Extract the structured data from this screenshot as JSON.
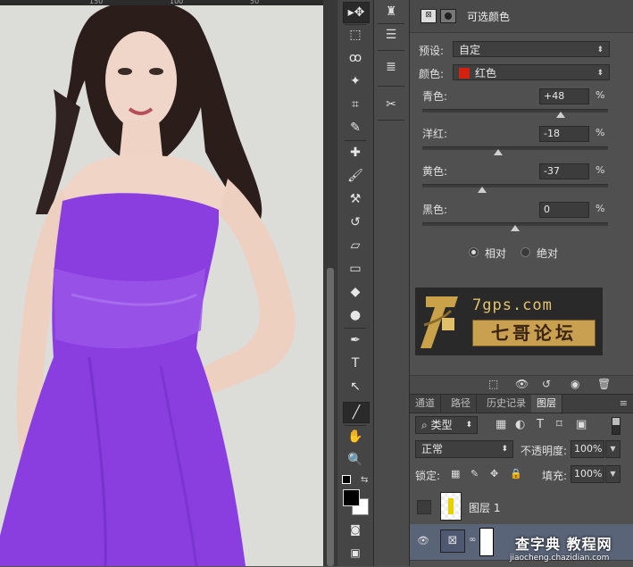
{
  "ruler": {
    "ticks": [
      "150",
      "100",
      "50"
    ]
  },
  "tools": [
    {
      "icon": "move-icon",
      "glyph": "▸✥"
    },
    {
      "icon": "marquee-icon",
      "glyph": "⬚"
    },
    {
      "icon": "lasso-icon",
      "glyph": "ꝏ"
    },
    {
      "icon": "magic-wand-icon",
      "glyph": "✦"
    },
    {
      "icon": "crop-icon",
      "glyph": "⌗"
    },
    {
      "icon": "eyedropper-icon",
      "glyph": "✎"
    },
    {
      "icon": "healing-brush-icon",
      "glyph": "✚"
    },
    {
      "icon": "brush-icon",
      "glyph": "🖌"
    },
    {
      "icon": "clone-stamp-icon",
      "glyph": "⚒"
    },
    {
      "icon": "history-brush-icon",
      "glyph": "↺"
    },
    {
      "icon": "eraser-icon",
      "glyph": "▱"
    },
    {
      "icon": "gradient-icon",
      "glyph": "▭"
    },
    {
      "icon": "blur-icon",
      "glyph": "◆"
    },
    {
      "icon": "dodge-icon",
      "glyph": "●"
    },
    {
      "icon": "pen-icon",
      "glyph": "✒"
    },
    {
      "icon": "type-icon",
      "glyph": "T"
    },
    {
      "icon": "path-selection-icon",
      "glyph": "↖"
    },
    {
      "icon": "line-icon",
      "glyph": "╱"
    },
    {
      "icon": "hand-icon",
      "glyph": "✋"
    },
    {
      "icon": "zoom-icon",
      "glyph": "🔍"
    }
  ],
  "properties": {
    "title": "可选颜色",
    "preset_label": "预设:",
    "preset_value": "自定",
    "colors_label": "颜色:",
    "colors_value": "红色",
    "colors_swatch": "#d4200f",
    "sliders": [
      {
        "label": "青色:",
        "value": "+48",
        "pct": "%",
        "level": 0.74
      },
      {
        "label": "洋红:",
        "value": "-18",
        "pct": "%",
        "level": 0.41
      },
      {
        "label": "黄色:",
        "value": "-37",
        "pct": "%",
        "level": 0.32
      },
      {
        "label": "黑色:",
        "value": "0",
        "pct": "%",
        "level": 0.5
      }
    ],
    "method_relative": "相对",
    "method_absolute": "绝对",
    "method_selected": "relative",
    "watermark_url": "7gps.com",
    "watermark_name": "七哥论坛"
  },
  "layers": {
    "tabs": [
      "通道",
      "路径",
      "历史记录",
      "图层"
    ],
    "active_tab": 3,
    "filter_kind": "类型",
    "blend_mode": "正常",
    "opacity_label": "不透明度:",
    "opacity_value": "100%",
    "lock_label": "锁定:",
    "fill_label": "填充:",
    "fill_value": "100%",
    "layer_names": [
      "图层 1"
    ],
    "site_watermark": "查字典 教程网",
    "site_url": "jiaocheng.chazidian.com"
  },
  "colors": {
    "dress": "#8a3ee0",
    "panel": "#505050",
    "accent_fg": "#000000",
    "accent_bg": "#ffffff"
  }
}
